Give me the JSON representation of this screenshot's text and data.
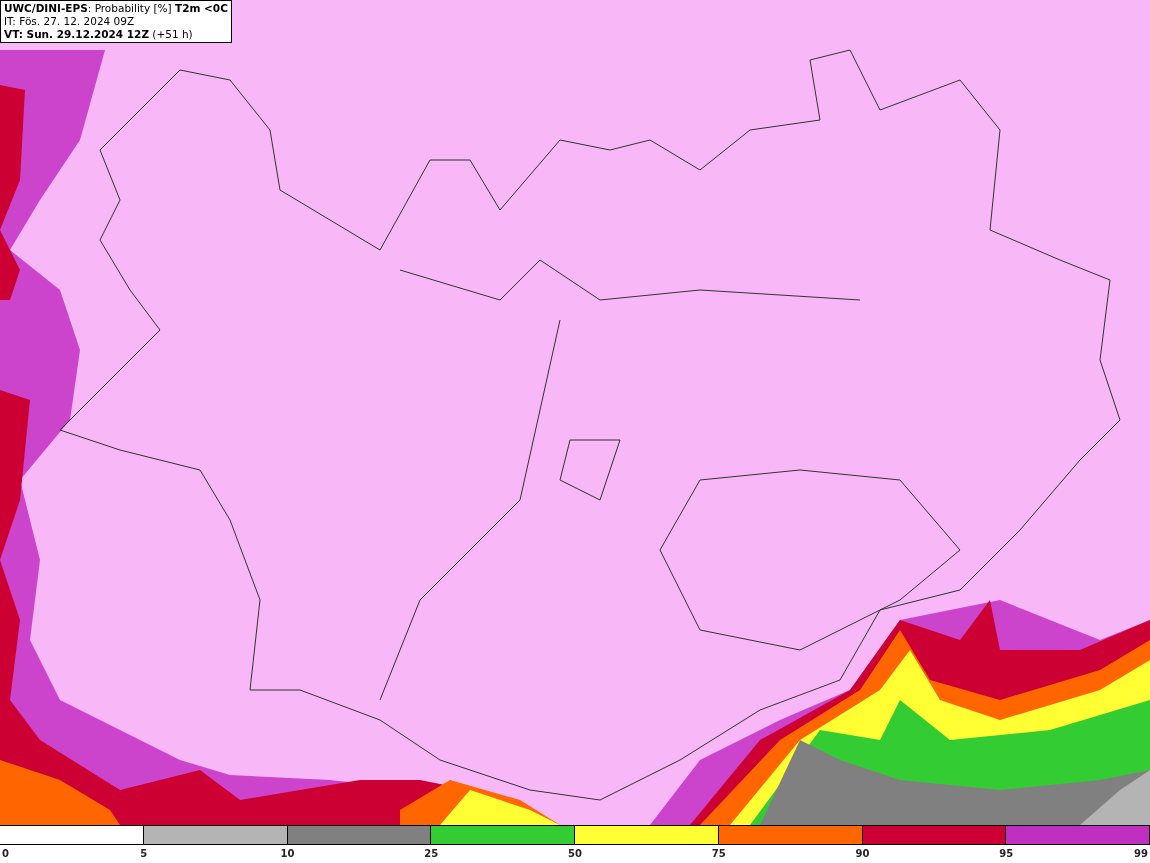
{
  "header": {
    "title": "**UWC/DINI-EPS**: Probability [%] **T2m <0C**",
    "initial_time": "IT: Fös. 27. 12. 2024 09Z",
    "valid_time": "**VT: Sun. 29.12.2024 12Z** (+51 h)"
  },
  "legend": {
    "segments": [
      {
        "color": "#ffffff"
      },
      {
        "color": "#b4b4b4"
      },
      {
        "color": "#808080"
      },
      {
        "color": "#33cc33"
      },
      {
        "color": "#ffff33"
      },
      {
        "color": "#ff6600"
      },
      {
        "color": "#cc0033"
      },
      {
        "color": "#c030c0"
      }
    ],
    "ticks": [
      "0",
      "5",
      "10",
      "25",
      "50",
      "75",
      "90",
      "95",
      "99"
    ]
  }
}
